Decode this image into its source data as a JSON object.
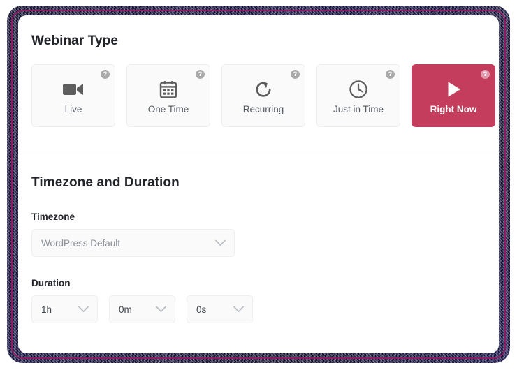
{
  "panel": {
    "sections": [
      {
        "id": "webinar-type",
        "title": "Webinar Type"
      },
      {
        "id": "timezone-duration",
        "title": "Timezone and Duration"
      }
    ]
  },
  "webinar_type": {
    "title": "Webinar Type",
    "help_glyph": "?",
    "selected_accent_color": "#c43d5c",
    "cards": [
      {
        "label": "Live",
        "icon": "video-camera-icon",
        "selected": false,
        "help": "?"
      },
      {
        "label": "One Time",
        "icon": "calendar-icon",
        "selected": false,
        "help": "?"
      },
      {
        "label": "Recurring",
        "icon": "refresh-arrow-icon",
        "selected": false,
        "help": "?"
      },
      {
        "label": "Just in Time",
        "icon": "clock-icon",
        "selected": false,
        "help": "?"
      },
      {
        "label": "Right Now",
        "icon": "play-icon",
        "selected": true,
        "help": "?"
      }
    ]
  },
  "timezone_duration": {
    "title": "Timezone and Duration",
    "timezone": {
      "label": "Timezone",
      "value": "WordPress Default",
      "placeholder": "WordPress Default",
      "chevron": "chevron-down-icon"
    },
    "duration": {
      "label": "Duration",
      "fields": [
        {
          "name": "hours",
          "value": "1h"
        },
        {
          "name": "minutes",
          "value": "0m"
        },
        {
          "name": "seconds",
          "value": "0s"
        }
      ]
    }
  }
}
